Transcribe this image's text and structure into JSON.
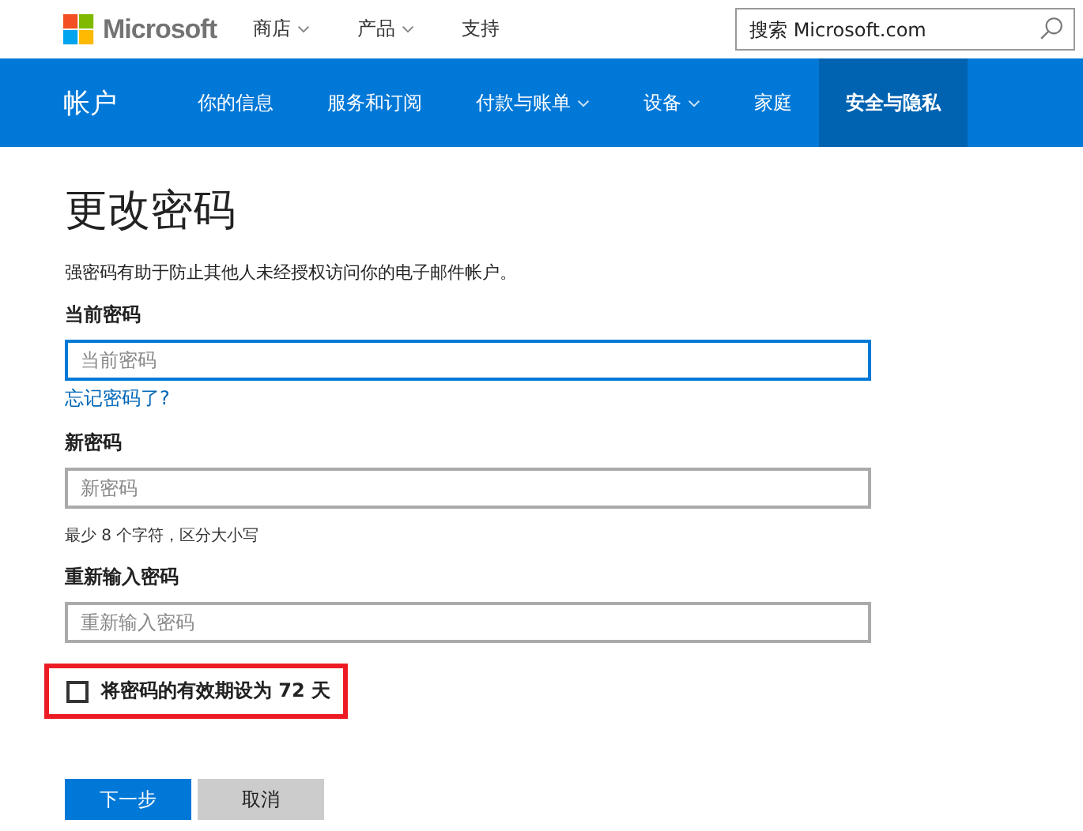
{
  "header": {
    "logo_text": "Microsoft",
    "nav": [
      {
        "label": "商店",
        "has_menu": true
      },
      {
        "label": "产品",
        "has_menu": true
      },
      {
        "label": "支持",
        "has_menu": false
      }
    ],
    "search": {
      "placeholder": "搜索 Microsoft.com"
    }
  },
  "account_nav": {
    "title": "帐户",
    "items": [
      {
        "label": "你的信息",
        "has_menu": false,
        "selected": false
      },
      {
        "label": "服务和订阅",
        "has_menu": false,
        "selected": false
      },
      {
        "label": "付款与账单",
        "has_menu": true,
        "selected": false
      },
      {
        "label": "设备",
        "has_menu": true,
        "selected": false
      },
      {
        "label": "家庭",
        "has_menu": false,
        "selected": false
      },
      {
        "label": "安全与隐私",
        "has_menu": false,
        "selected": true
      }
    ]
  },
  "form": {
    "title": "更改密码",
    "description": "强密码有助于防止其他人未经授权访问你的电子邮件帐户。",
    "fields": [
      {
        "label": "当前密码",
        "placeholder": "当前密码",
        "focused": true,
        "link": "忘记密码了?"
      },
      {
        "label": "新密码",
        "placeholder": "新密码",
        "focused": false,
        "hint": "最少 8 个字符，区分大小写"
      },
      {
        "label": "重新输入密码",
        "placeholder": "重新输入密码",
        "focused": false
      }
    ],
    "checkbox": {
      "label": "将密码的有效期设为 72 天",
      "checked": false,
      "highlighted": true
    },
    "buttons": [
      {
        "label": "下一步",
        "kind": "primary"
      },
      {
        "label": "取消",
        "kind": "secondary"
      }
    ]
  }
}
